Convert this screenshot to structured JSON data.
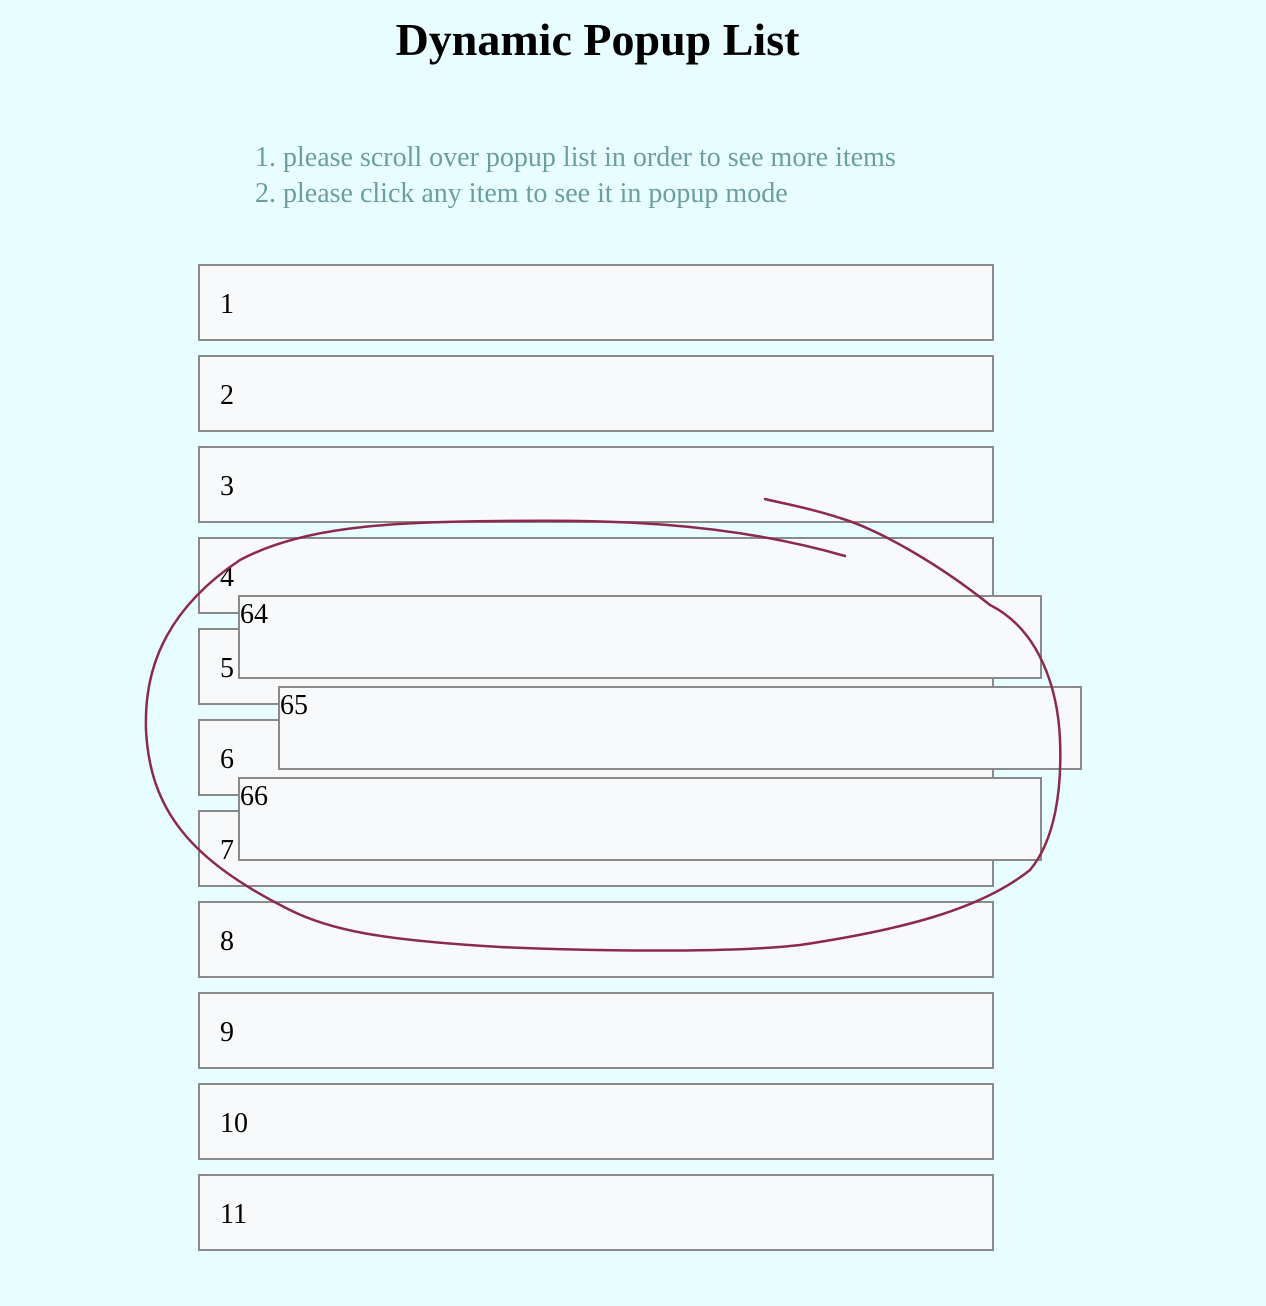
{
  "page": {
    "title": "Dynamic Popup List"
  },
  "instructions": [
    "1. please scroll over popup list in order to see more items",
    "2. please click any item to see it in popup mode"
  ],
  "list": {
    "items": [
      "1",
      "2",
      "3",
      "4",
      "5",
      "6",
      "7",
      "8",
      "9",
      "10",
      "11"
    ]
  },
  "popup": {
    "items": [
      "64",
      "65",
      "66"
    ]
  },
  "colors": {
    "background": "#e8fdff",
    "item_background": "#f7f9fb",
    "item_border": "#8a8a8a",
    "instruction_text": "#6b9e9e",
    "annotation_stroke": "#8b2a4e"
  }
}
